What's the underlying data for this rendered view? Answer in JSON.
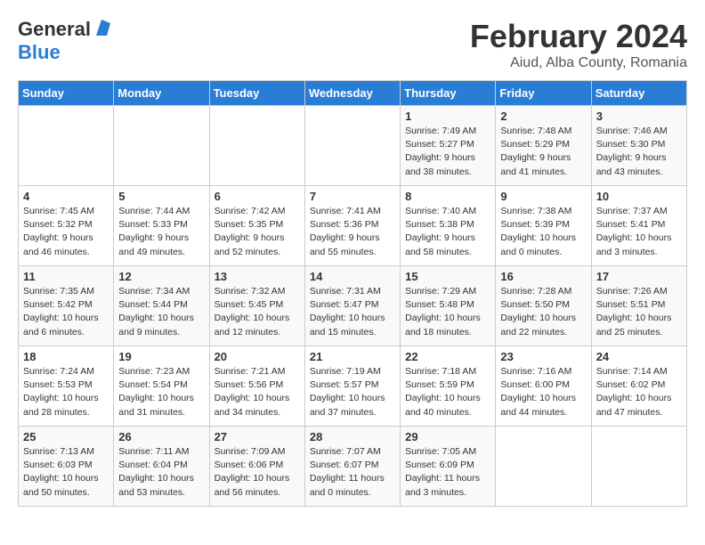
{
  "header": {
    "logo_general": "General",
    "logo_blue": "Blue",
    "title": "February 2024",
    "subtitle": "Aiud, Alba County, Romania"
  },
  "days_of_week": [
    "Sunday",
    "Monday",
    "Tuesday",
    "Wednesday",
    "Thursday",
    "Friday",
    "Saturday"
  ],
  "weeks": [
    [
      {
        "day": "",
        "info": ""
      },
      {
        "day": "",
        "info": ""
      },
      {
        "day": "",
        "info": ""
      },
      {
        "day": "",
        "info": ""
      },
      {
        "day": "1",
        "info": "Sunrise: 7:49 AM\nSunset: 5:27 PM\nDaylight: 9 hours\nand 38 minutes."
      },
      {
        "day": "2",
        "info": "Sunrise: 7:48 AM\nSunset: 5:29 PM\nDaylight: 9 hours\nand 41 minutes."
      },
      {
        "day": "3",
        "info": "Sunrise: 7:46 AM\nSunset: 5:30 PM\nDaylight: 9 hours\nand 43 minutes."
      }
    ],
    [
      {
        "day": "4",
        "info": "Sunrise: 7:45 AM\nSunset: 5:32 PM\nDaylight: 9 hours\nand 46 minutes."
      },
      {
        "day": "5",
        "info": "Sunrise: 7:44 AM\nSunset: 5:33 PM\nDaylight: 9 hours\nand 49 minutes."
      },
      {
        "day": "6",
        "info": "Sunrise: 7:42 AM\nSunset: 5:35 PM\nDaylight: 9 hours\nand 52 minutes."
      },
      {
        "day": "7",
        "info": "Sunrise: 7:41 AM\nSunset: 5:36 PM\nDaylight: 9 hours\nand 55 minutes."
      },
      {
        "day": "8",
        "info": "Sunrise: 7:40 AM\nSunset: 5:38 PM\nDaylight: 9 hours\nand 58 minutes."
      },
      {
        "day": "9",
        "info": "Sunrise: 7:38 AM\nSunset: 5:39 PM\nDaylight: 10 hours\nand 0 minutes."
      },
      {
        "day": "10",
        "info": "Sunrise: 7:37 AM\nSunset: 5:41 PM\nDaylight: 10 hours\nand 3 minutes."
      }
    ],
    [
      {
        "day": "11",
        "info": "Sunrise: 7:35 AM\nSunset: 5:42 PM\nDaylight: 10 hours\nand 6 minutes."
      },
      {
        "day": "12",
        "info": "Sunrise: 7:34 AM\nSunset: 5:44 PM\nDaylight: 10 hours\nand 9 minutes."
      },
      {
        "day": "13",
        "info": "Sunrise: 7:32 AM\nSunset: 5:45 PM\nDaylight: 10 hours\nand 12 minutes."
      },
      {
        "day": "14",
        "info": "Sunrise: 7:31 AM\nSunset: 5:47 PM\nDaylight: 10 hours\nand 15 minutes."
      },
      {
        "day": "15",
        "info": "Sunrise: 7:29 AM\nSunset: 5:48 PM\nDaylight: 10 hours\nand 18 minutes."
      },
      {
        "day": "16",
        "info": "Sunrise: 7:28 AM\nSunset: 5:50 PM\nDaylight: 10 hours\nand 22 minutes."
      },
      {
        "day": "17",
        "info": "Sunrise: 7:26 AM\nSunset: 5:51 PM\nDaylight: 10 hours\nand 25 minutes."
      }
    ],
    [
      {
        "day": "18",
        "info": "Sunrise: 7:24 AM\nSunset: 5:53 PM\nDaylight: 10 hours\nand 28 minutes."
      },
      {
        "day": "19",
        "info": "Sunrise: 7:23 AM\nSunset: 5:54 PM\nDaylight: 10 hours\nand 31 minutes."
      },
      {
        "day": "20",
        "info": "Sunrise: 7:21 AM\nSunset: 5:56 PM\nDaylight: 10 hours\nand 34 minutes."
      },
      {
        "day": "21",
        "info": "Sunrise: 7:19 AM\nSunset: 5:57 PM\nDaylight: 10 hours\nand 37 minutes."
      },
      {
        "day": "22",
        "info": "Sunrise: 7:18 AM\nSunset: 5:59 PM\nDaylight: 10 hours\nand 40 minutes."
      },
      {
        "day": "23",
        "info": "Sunrise: 7:16 AM\nSunset: 6:00 PM\nDaylight: 10 hours\nand 44 minutes."
      },
      {
        "day": "24",
        "info": "Sunrise: 7:14 AM\nSunset: 6:02 PM\nDaylight: 10 hours\nand 47 minutes."
      }
    ],
    [
      {
        "day": "25",
        "info": "Sunrise: 7:13 AM\nSunset: 6:03 PM\nDaylight: 10 hours\nand 50 minutes."
      },
      {
        "day": "26",
        "info": "Sunrise: 7:11 AM\nSunset: 6:04 PM\nDaylight: 10 hours\nand 53 minutes."
      },
      {
        "day": "27",
        "info": "Sunrise: 7:09 AM\nSunset: 6:06 PM\nDaylight: 10 hours\nand 56 minutes."
      },
      {
        "day": "28",
        "info": "Sunrise: 7:07 AM\nSunset: 6:07 PM\nDaylight: 11 hours\nand 0 minutes."
      },
      {
        "day": "29",
        "info": "Sunrise: 7:05 AM\nSunset: 6:09 PM\nDaylight: 11 hours\nand 3 minutes."
      },
      {
        "day": "",
        "info": ""
      },
      {
        "day": "",
        "info": ""
      }
    ]
  ]
}
